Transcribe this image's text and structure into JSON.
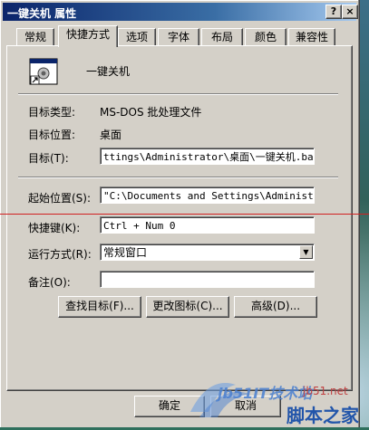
{
  "window": {
    "title": "一键关机 属性",
    "help_glyph": "?",
    "close_glyph": "×"
  },
  "tabs": [
    {
      "label": "常规"
    },
    {
      "label": "快捷方式"
    },
    {
      "label": "选项"
    },
    {
      "label": "字体"
    },
    {
      "label": "布局"
    },
    {
      "label": "颜色"
    },
    {
      "label": "兼容性"
    }
  ],
  "active_tab": "快捷方式",
  "shortcut": {
    "name": "一键关机",
    "icon": "ms-dos-shortcut-icon",
    "target_type_label": "目标类型:",
    "target_type_value": "MS-DOS 批处理文件",
    "target_location_label": "目标位置:",
    "target_location_value": "桌面",
    "target_label": "目标(T):",
    "target_value": "ttings\\Administrator\\桌面\\一键关机.bat\"",
    "start_in_label": "起始位置(S):",
    "start_in_value": "\"C:\\Documents and Settings\\Administrato",
    "hotkey_label": "快捷键(K):",
    "hotkey_value": "Ctrl + Num 0",
    "run_label": "运行方式(R):",
    "run_value": "常规窗口",
    "comment_label": "备注(O):",
    "comment_value": ""
  },
  "buttons": {
    "find_target": "查找目标(F)...",
    "change_icon": "更改图标(C)...",
    "advanced": "高级(D)...",
    "ok": "确定",
    "cancel": "取消"
  },
  "watermark": {
    "text1": "jb51IT技术站",
    "text2": "jb51.net",
    "text3": "脚本之家"
  },
  "colors": {
    "title_bar": "#0a246a",
    "face": "#d4d0c8",
    "annotation_line": "#d02020"
  }
}
